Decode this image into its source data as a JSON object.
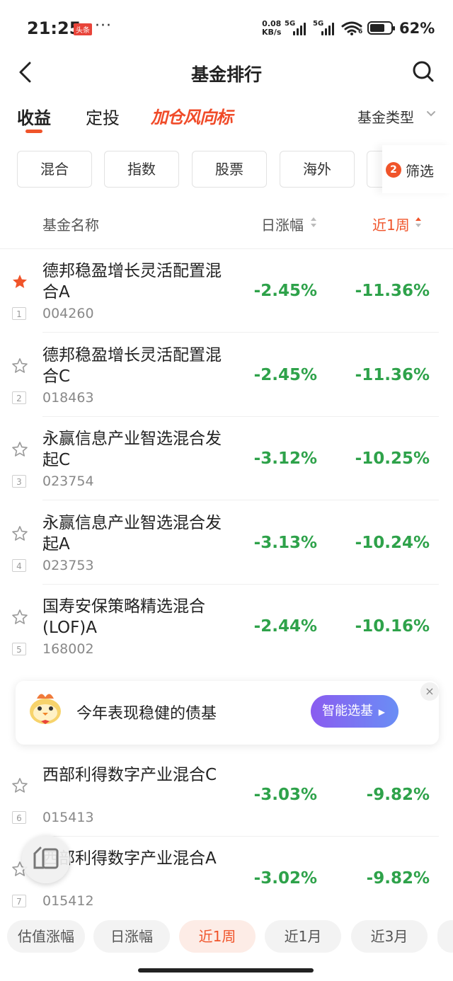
{
  "status": {
    "time": "21:25",
    "news_badge": "头条",
    "dots": "···",
    "speed_value": "0.08",
    "speed_unit": "KB/s",
    "sig1": "5G",
    "sig2": "5G",
    "wifi_num": "6",
    "battery": "62%"
  },
  "header": {
    "title": "基金排行"
  },
  "tabs": {
    "items": [
      "收益",
      "定投"
    ],
    "brand": "加仓风向标",
    "type_label": "基金类型"
  },
  "chips": [
    "混合",
    "指数",
    "股票",
    "海外"
  ],
  "filter": {
    "count": "2",
    "label": "筛选"
  },
  "columns": {
    "name": "基金名称",
    "daily": "日涨幅",
    "week": "近1周"
  },
  "funds": [
    {
      "name": "德邦稳盈增长灵活配置混合A",
      "code": "004260",
      "rank": "1",
      "daily": "-2.45%",
      "week": "-11.36%",
      "starred": true
    },
    {
      "name": "德邦稳盈增长灵活配置混合C",
      "code": "018463",
      "rank": "2",
      "daily": "-2.45%",
      "week": "-11.36%",
      "starred": false
    },
    {
      "name": "永赢信息产业智选混合发起C",
      "code": "023754",
      "rank": "3",
      "daily": "-3.12%",
      "week": "-10.25%",
      "starred": false
    },
    {
      "name": "永赢信息产业智选混合发起A",
      "code": "023753",
      "rank": "4",
      "daily": "-3.13%",
      "week": "-10.24%",
      "starred": false
    },
    {
      "name": "国寿安保策略精选混合(LOF)A",
      "code": "168002",
      "rank": "5",
      "daily": "-2.44%",
      "week": "-10.16%",
      "starred": false
    },
    {
      "name": "西部利得数字产业混合C",
      "code": "015413",
      "rank": "6",
      "daily": "-3.03%",
      "week": "-9.82%",
      "starred": false
    },
    {
      "name": "西部利得数字产业混合A",
      "code": "015412",
      "rank": "7",
      "daily": "-3.02%",
      "week": "-9.82%",
      "starred": false
    }
  ],
  "promo": {
    "text": "今年表现稳健的债基",
    "button": "智能选基",
    "close": "×"
  },
  "bottom_tabs": [
    "估值涨幅",
    "日涨幅",
    "近1周",
    "近1月",
    "近3月"
  ],
  "colors": {
    "accent": "#f0542a",
    "down": "#2ea24a"
  }
}
